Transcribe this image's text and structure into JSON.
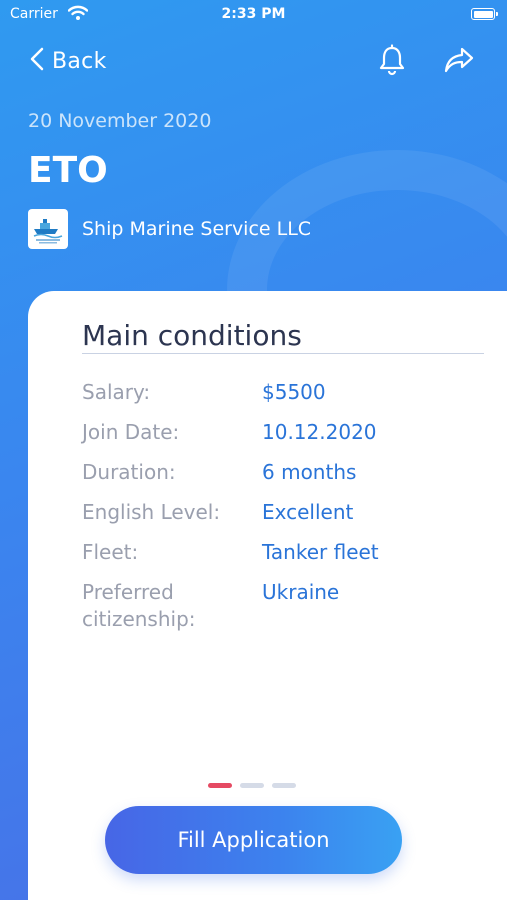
{
  "status_bar": {
    "carrier": "Carrier",
    "time": "2:33 PM",
    "battery": "full"
  },
  "nav": {
    "back_label": "Back",
    "icons": [
      "bell-icon",
      "share-icon"
    ]
  },
  "job": {
    "date": "20 November 2020",
    "title": "ETO",
    "company": "Ship Marine Service LLC"
  },
  "conditions": {
    "title": "Main conditions",
    "rows": [
      {
        "label": "Salary:",
        "value": "$5500"
      },
      {
        "label": "Join Date:",
        "value": "10.12.2020"
      },
      {
        "label": "Duration:",
        "value": "6 months"
      },
      {
        "label": "English Level:",
        "value": "Excellent"
      },
      {
        "label": "Fleet:",
        "value": "Tanker fleet"
      },
      {
        "label": "Preferred citizenship:",
        "value": "Ukraine"
      }
    ]
  },
  "pager": {
    "count": 3,
    "active_index": 0
  },
  "actions": {
    "fill_application": "Fill Application"
  },
  "colors": {
    "accent": "#2a74d8",
    "pager_active": "#e54a63",
    "label": "#9a9fae",
    "heading": "#2c3550"
  }
}
